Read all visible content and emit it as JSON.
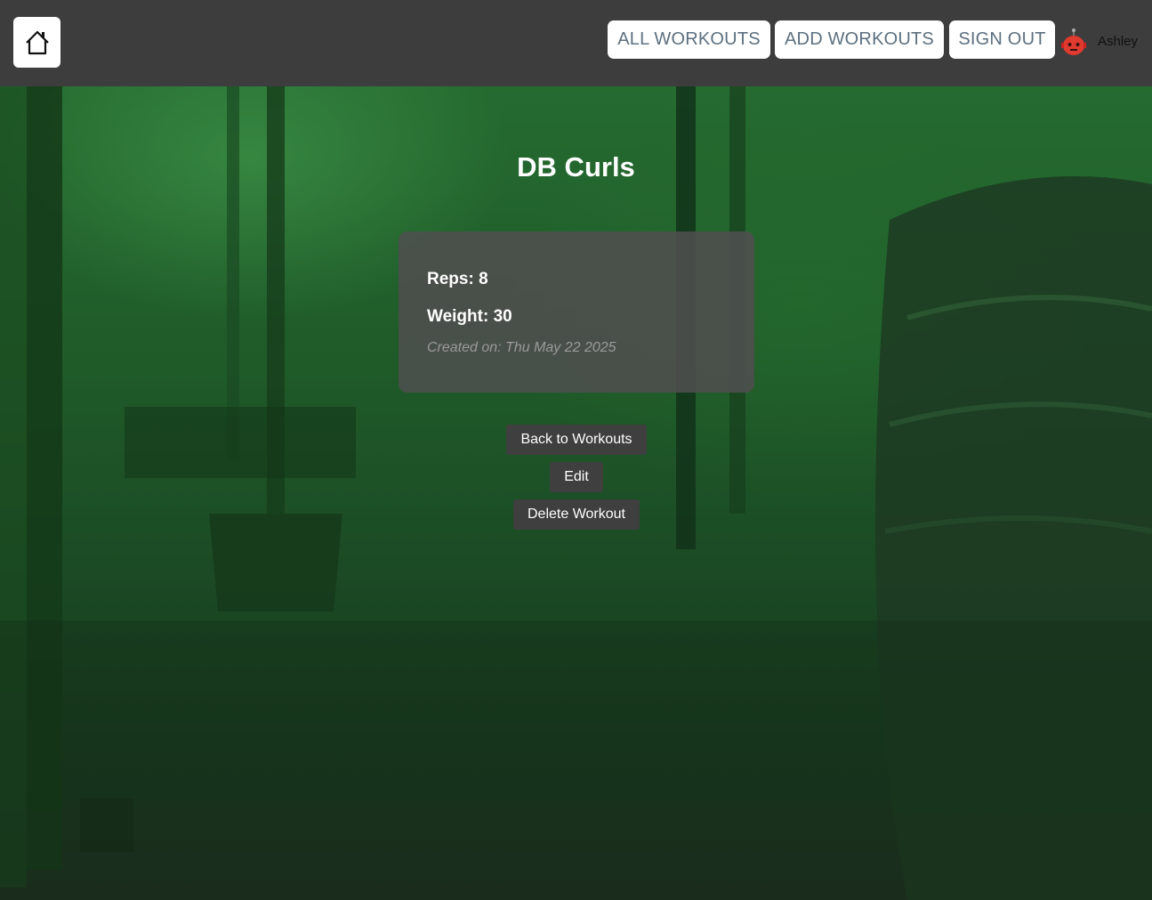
{
  "header": {
    "home_icon": "home-icon",
    "nav": {
      "all_workouts": "ALL WORKOUTS",
      "add_workouts": "ADD WORKOUTS",
      "sign_out": "SIGN OUT"
    },
    "avatar_icon": "robot-avatar",
    "username": "Ashley"
  },
  "workout": {
    "title": "DB Curls",
    "reps": "Reps: 8",
    "weight": "Weight: 30",
    "created": "Created on: Thu May 22 2025"
  },
  "actions": {
    "back": "Back to Workouts",
    "edit": "Edit",
    "delete": "Delete Workout"
  },
  "colors": {
    "header_bg": "#3e3d3e",
    "nav_text": "#5c7080",
    "card_bg": "#4e4e4e",
    "button_bg": "#3f3f3f",
    "background_green": "#256b30"
  }
}
